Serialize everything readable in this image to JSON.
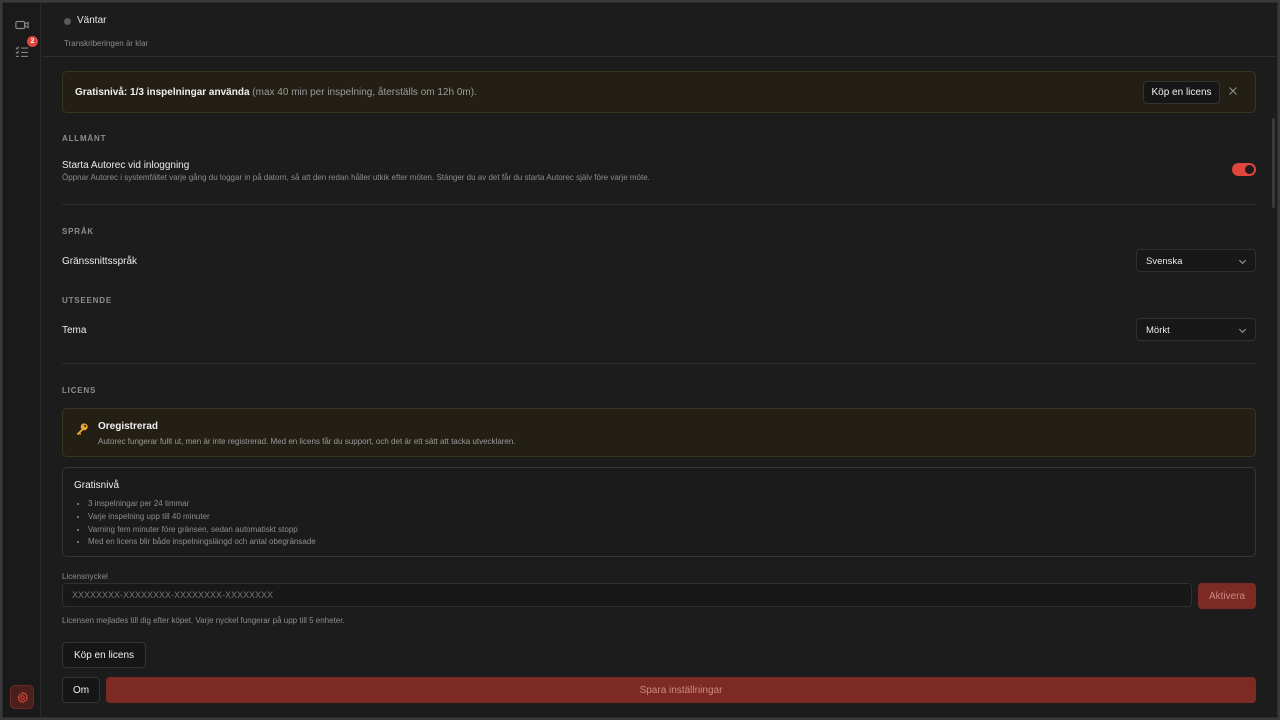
{
  "header": {
    "status_title": "Väntar",
    "status_subtitle": "Transkriberingen är klar"
  },
  "rail": {
    "record_icon": "video-icon",
    "tasks_icon": "list-checks-icon",
    "tasks_badge": "2",
    "settings_icon": "gear-icon"
  },
  "notice": {
    "bold_text": "Gratisnivå: 1/3 inspelningar använda",
    "muted_text": " (max 40 min per inspelning, återställs om 12h 0m).",
    "buy_label": "Köp en licens",
    "close_icon": "close-icon"
  },
  "general": {
    "section_label": "ALLMÄNT",
    "autostart_title": "Starta Autorec vid inloggning",
    "autostart_desc": "Öppnar Autorec i systemfältet varje gång du loggar in på datorn, så att den redan håller utkik efter möten. Stänger du av det får du starta Autorec själv före varje möte.",
    "autostart_enabled": true
  },
  "language": {
    "section_label": "SPRÅK",
    "title": "Gränssnittsspråk",
    "value": "Svenska"
  },
  "appearance": {
    "section_label": "UTSEENDE",
    "title": "Tema",
    "value": "Mörkt"
  },
  "license": {
    "section_label": "LICENS",
    "card_title": "Oregistrerad",
    "card_desc": "Autorec fungerar fullt ut, men är inte registrerad. Med en licens får du support, och det är ett sätt att tacka utvecklaren.",
    "free_title": "Gratisnivå",
    "free_items": [
      "3 inspelningar per 24 timmar",
      "Varje inspelning upp till 40 minuter",
      "Varning fem minuter före gränsen, sedan automatiskt stopp",
      "Med en licens blir både inspelningslängd och antal obegränsade"
    ],
    "key_label": "Licensnyckel",
    "key_placeholder": "XXXXXXXX-XXXXXXXX-XXXXXXXX-XXXXXXXX",
    "activate_label": "Aktivera",
    "key_help": "Licensen mejlades till dig efter köpet. Varje nyckel fungerar på upp till 5 enheter.",
    "buy_label": "Köp en licens"
  },
  "footer": {
    "about_label": "Om",
    "save_label": "Spara inställningar"
  },
  "colors": {
    "accent": "#e0463b",
    "save_button": "#7d2a24"
  }
}
